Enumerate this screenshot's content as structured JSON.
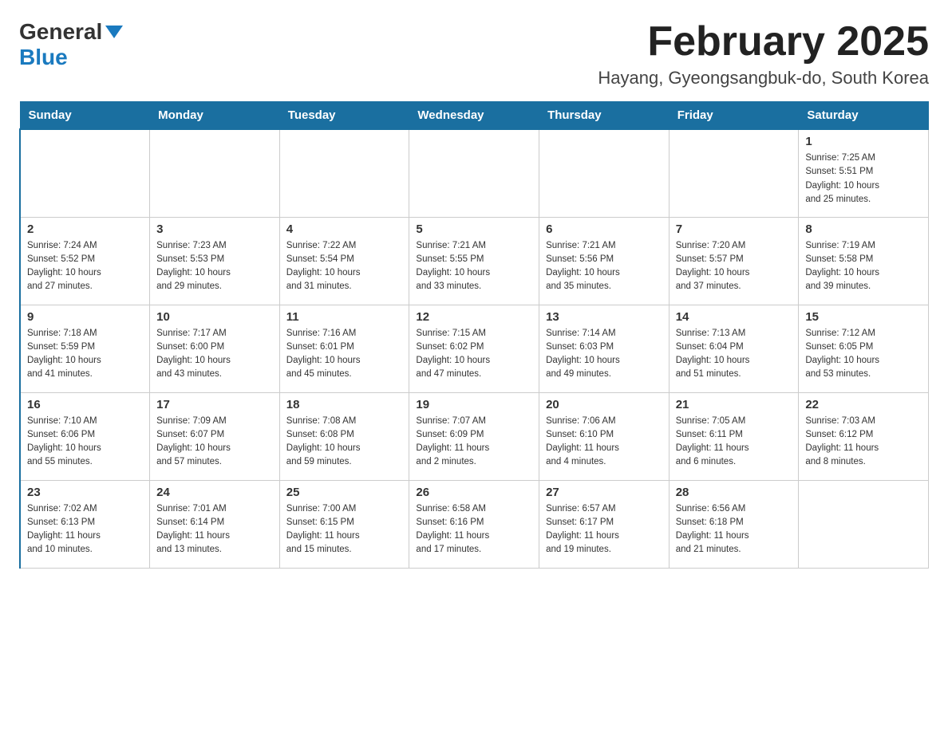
{
  "header": {
    "logo_general": "General",
    "logo_blue": "Blue",
    "title": "February 2025",
    "subtitle": "Hayang, Gyeongsangbuk-do, South Korea"
  },
  "weekdays": [
    "Sunday",
    "Monday",
    "Tuesday",
    "Wednesday",
    "Thursday",
    "Friday",
    "Saturday"
  ],
  "weeks": [
    [
      {
        "day": "",
        "info": ""
      },
      {
        "day": "",
        "info": ""
      },
      {
        "day": "",
        "info": ""
      },
      {
        "day": "",
        "info": ""
      },
      {
        "day": "",
        "info": ""
      },
      {
        "day": "",
        "info": ""
      },
      {
        "day": "1",
        "info": "Sunrise: 7:25 AM\nSunset: 5:51 PM\nDaylight: 10 hours\nand 25 minutes."
      }
    ],
    [
      {
        "day": "2",
        "info": "Sunrise: 7:24 AM\nSunset: 5:52 PM\nDaylight: 10 hours\nand 27 minutes."
      },
      {
        "day": "3",
        "info": "Sunrise: 7:23 AM\nSunset: 5:53 PM\nDaylight: 10 hours\nand 29 minutes."
      },
      {
        "day": "4",
        "info": "Sunrise: 7:22 AM\nSunset: 5:54 PM\nDaylight: 10 hours\nand 31 minutes."
      },
      {
        "day": "5",
        "info": "Sunrise: 7:21 AM\nSunset: 5:55 PM\nDaylight: 10 hours\nand 33 minutes."
      },
      {
        "day": "6",
        "info": "Sunrise: 7:21 AM\nSunset: 5:56 PM\nDaylight: 10 hours\nand 35 minutes."
      },
      {
        "day": "7",
        "info": "Sunrise: 7:20 AM\nSunset: 5:57 PM\nDaylight: 10 hours\nand 37 minutes."
      },
      {
        "day": "8",
        "info": "Sunrise: 7:19 AM\nSunset: 5:58 PM\nDaylight: 10 hours\nand 39 minutes."
      }
    ],
    [
      {
        "day": "9",
        "info": "Sunrise: 7:18 AM\nSunset: 5:59 PM\nDaylight: 10 hours\nand 41 minutes."
      },
      {
        "day": "10",
        "info": "Sunrise: 7:17 AM\nSunset: 6:00 PM\nDaylight: 10 hours\nand 43 minutes."
      },
      {
        "day": "11",
        "info": "Sunrise: 7:16 AM\nSunset: 6:01 PM\nDaylight: 10 hours\nand 45 minutes."
      },
      {
        "day": "12",
        "info": "Sunrise: 7:15 AM\nSunset: 6:02 PM\nDaylight: 10 hours\nand 47 minutes."
      },
      {
        "day": "13",
        "info": "Sunrise: 7:14 AM\nSunset: 6:03 PM\nDaylight: 10 hours\nand 49 minutes."
      },
      {
        "day": "14",
        "info": "Sunrise: 7:13 AM\nSunset: 6:04 PM\nDaylight: 10 hours\nand 51 minutes."
      },
      {
        "day": "15",
        "info": "Sunrise: 7:12 AM\nSunset: 6:05 PM\nDaylight: 10 hours\nand 53 minutes."
      }
    ],
    [
      {
        "day": "16",
        "info": "Sunrise: 7:10 AM\nSunset: 6:06 PM\nDaylight: 10 hours\nand 55 minutes."
      },
      {
        "day": "17",
        "info": "Sunrise: 7:09 AM\nSunset: 6:07 PM\nDaylight: 10 hours\nand 57 minutes."
      },
      {
        "day": "18",
        "info": "Sunrise: 7:08 AM\nSunset: 6:08 PM\nDaylight: 10 hours\nand 59 minutes."
      },
      {
        "day": "19",
        "info": "Sunrise: 7:07 AM\nSunset: 6:09 PM\nDaylight: 11 hours\nand 2 minutes."
      },
      {
        "day": "20",
        "info": "Sunrise: 7:06 AM\nSunset: 6:10 PM\nDaylight: 11 hours\nand 4 minutes."
      },
      {
        "day": "21",
        "info": "Sunrise: 7:05 AM\nSunset: 6:11 PM\nDaylight: 11 hours\nand 6 minutes."
      },
      {
        "day": "22",
        "info": "Sunrise: 7:03 AM\nSunset: 6:12 PM\nDaylight: 11 hours\nand 8 minutes."
      }
    ],
    [
      {
        "day": "23",
        "info": "Sunrise: 7:02 AM\nSunset: 6:13 PM\nDaylight: 11 hours\nand 10 minutes."
      },
      {
        "day": "24",
        "info": "Sunrise: 7:01 AM\nSunset: 6:14 PM\nDaylight: 11 hours\nand 13 minutes."
      },
      {
        "day": "25",
        "info": "Sunrise: 7:00 AM\nSunset: 6:15 PM\nDaylight: 11 hours\nand 15 minutes."
      },
      {
        "day": "26",
        "info": "Sunrise: 6:58 AM\nSunset: 6:16 PM\nDaylight: 11 hours\nand 17 minutes."
      },
      {
        "day": "27",
        "info": "Sunrise: 6:57 AM\nSunset: 6:17 PM\nDaylight: 11 hours\nand 19 minutes."
      },
      {
        "day": "28",
        "info": "Sunrise: 6:56 AM\nSunset: 6:18 PM\nDaylight: 11 hours\nand 21 minutes."
      },
      {
        "day": "",
        "info": ""
      }
    ]
  ]
}
